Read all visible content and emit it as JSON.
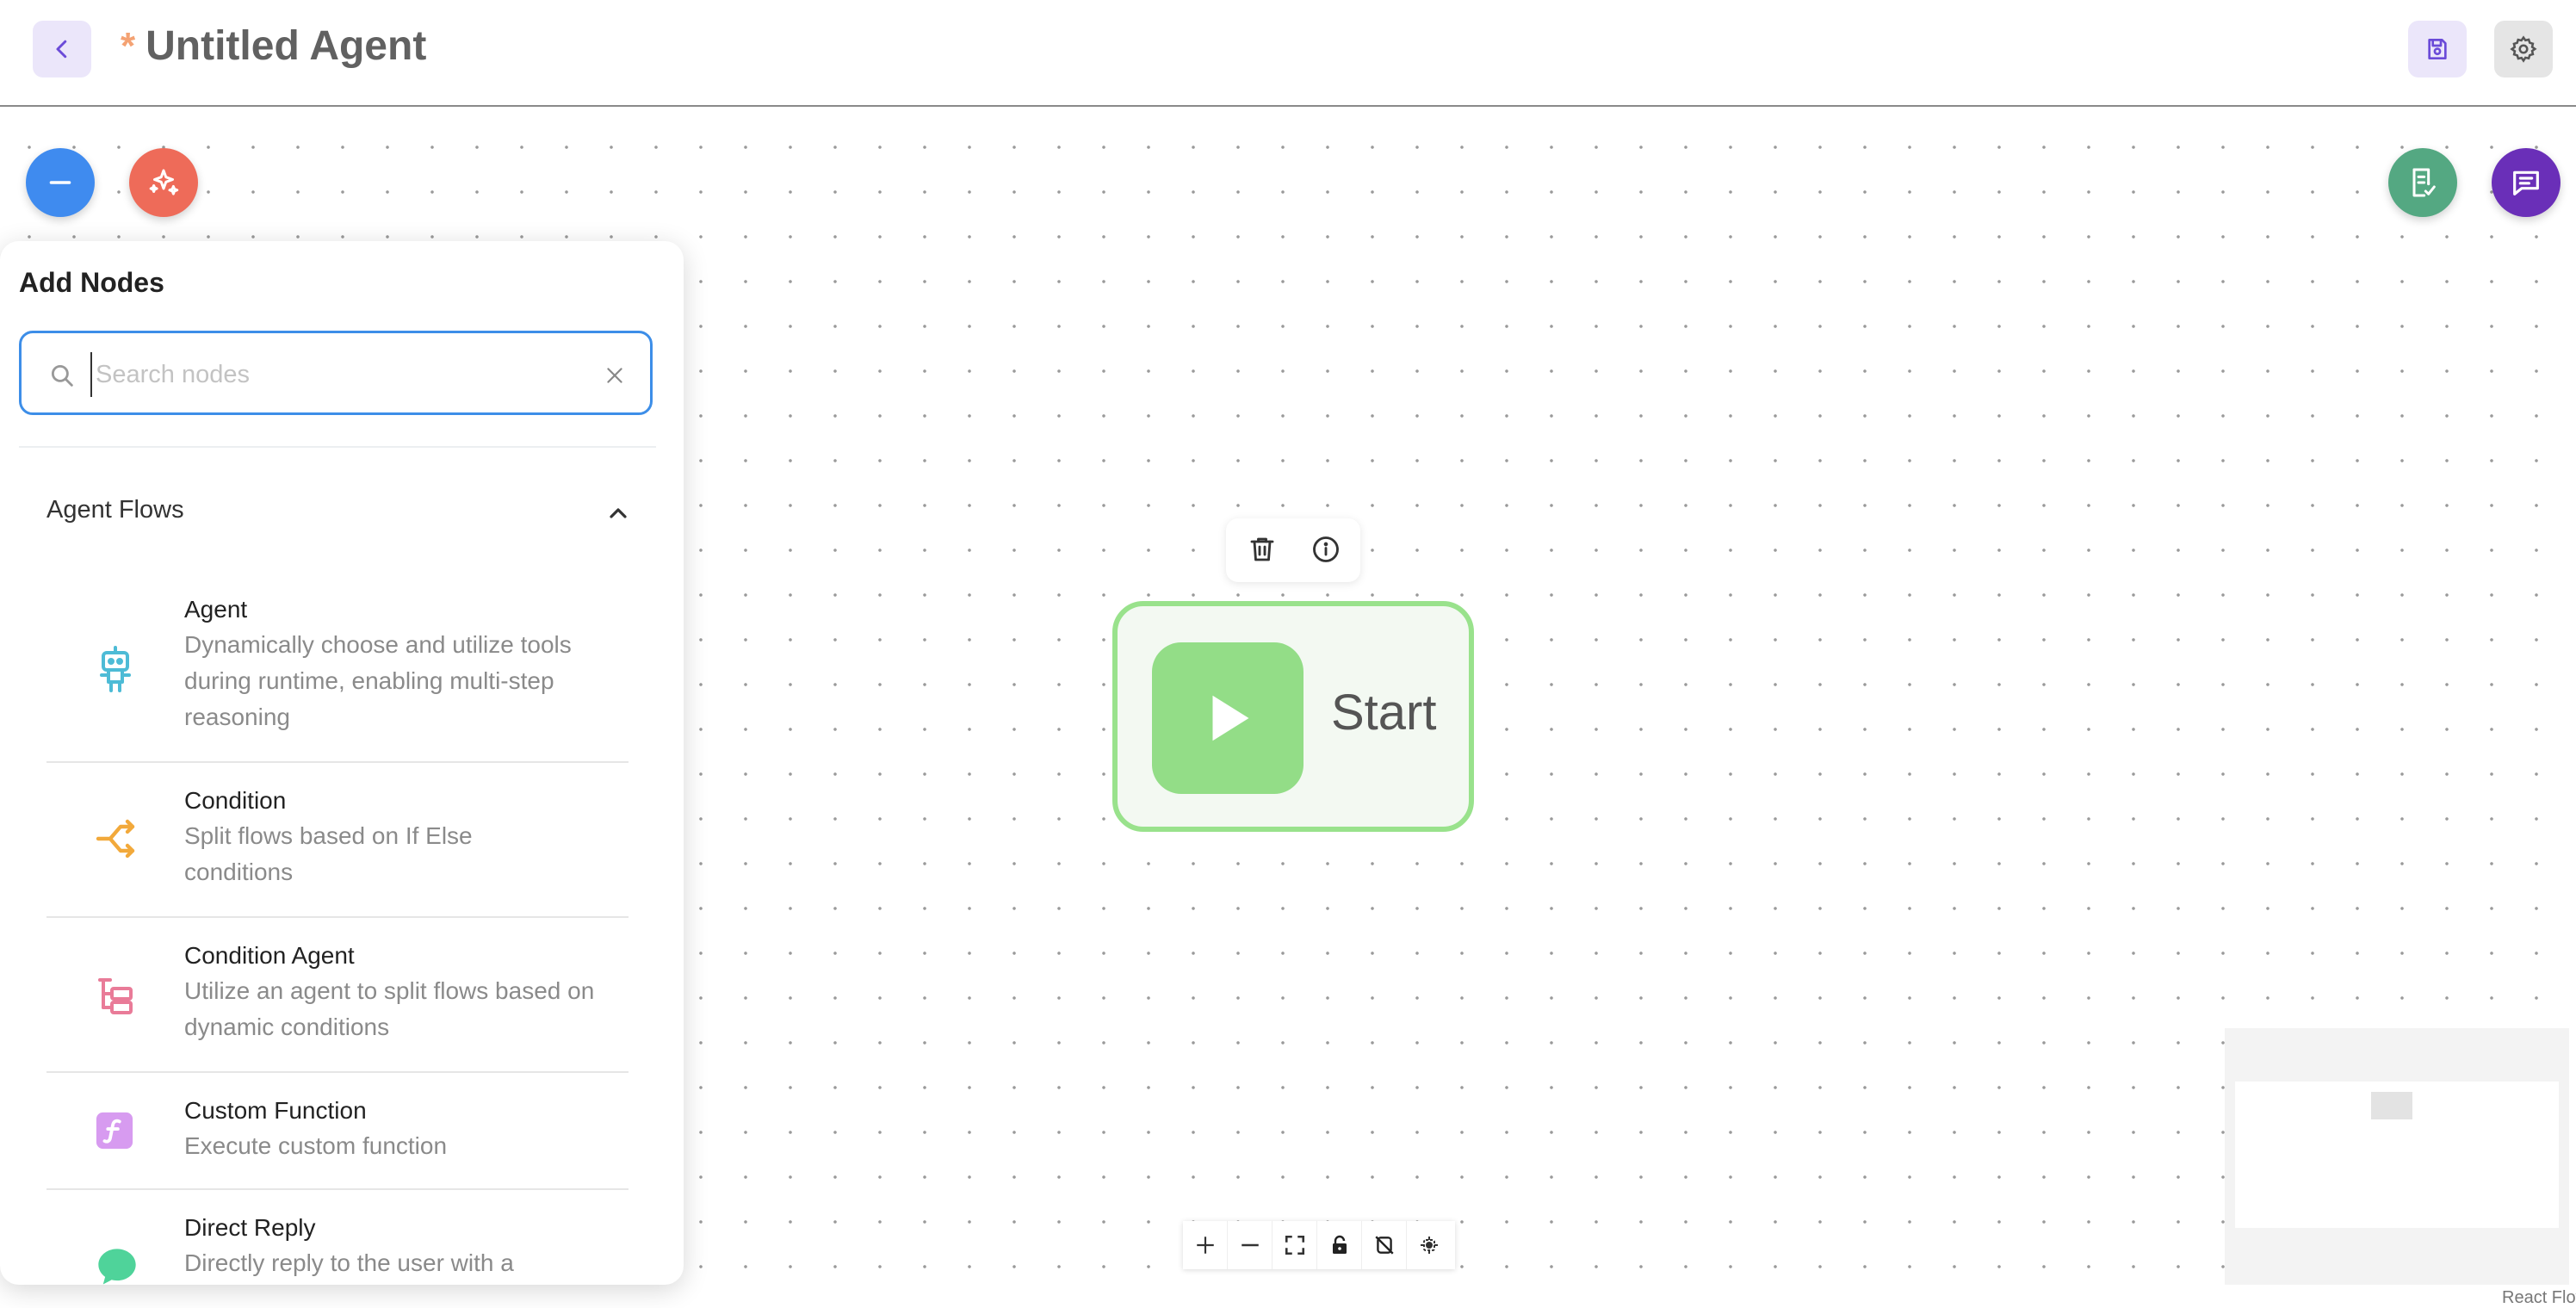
{
  "header": {
    "unsaved_marker": "*",
    "title": "Untitled Agent",
    "back_icon": "chevron-left-icon",
    "save_icon": "save-icon",
    "settings_icon": "gear-icon"
  },
  "fabs": {
    "collapse_icon": "minus-icon",
    "ai_icon": "sparkles-icon",
    "validate_icon": "checklist-icon",
    "chat_icon": "chat-icon",
    "colors": {
      "collapse": "#3f8bef",
      "ai": "#ee6b59",
      "validate": "#54a882",
      "chat": "#6a2fb8"
    }
  },
  "panel": {
    "title": "Add Nodes",
    "search": {
      "value": "",
      "placeholder": "Search nodes"
    },
    "section": {
      "title": "Agent Flows",
      "expanded": true
    },
    "items": [
      {
        "name": "Agent",
        "description": "Dynamically choose and utilize tools during runtime, enabling multi-step reasoning",
        "icon": "robot-icon",
        "color": "#4dbbd6"
      },
      {
        "name": "Condition",
        "description": "Split flows based on If Else conditions",
        "icon": "split-arrow-icon",
        "color": "#f2a93b"
      },
      {
        "name": "Condition Agent",
        "description": "Utilize an agent to split flows based on dynamic conditions",
        "icon": "tree-structure-icon",
        "color": "#e97b98"
      },
      {
        "name": "Custom Function",
        "description": "Execute custom function",
        "icon": "function-icon",
        "color": "#d79bf0"
      },
      {
        "name": "Direct Reply",
        "description": "Directly reply to the user with a",
        "icon": "message-bubble-icon",
        "color": "#4fd39a"
      }
    ]
  },
  "start_node": {
    "label": "Start",
    "icon": "play-icon",
    "toolbar": {
      "delete_icon": "trash-icon",
      "info_icon": "info-icon"
    }
  },
  "controls": [
    "zoom-in-icon",
    "zoom-out-icon",
    "fit-view-icon",
    "lock-icon",
    "hide-icon",
    "focus-icon"
  ],
  "attribution": "React Flow"
}
